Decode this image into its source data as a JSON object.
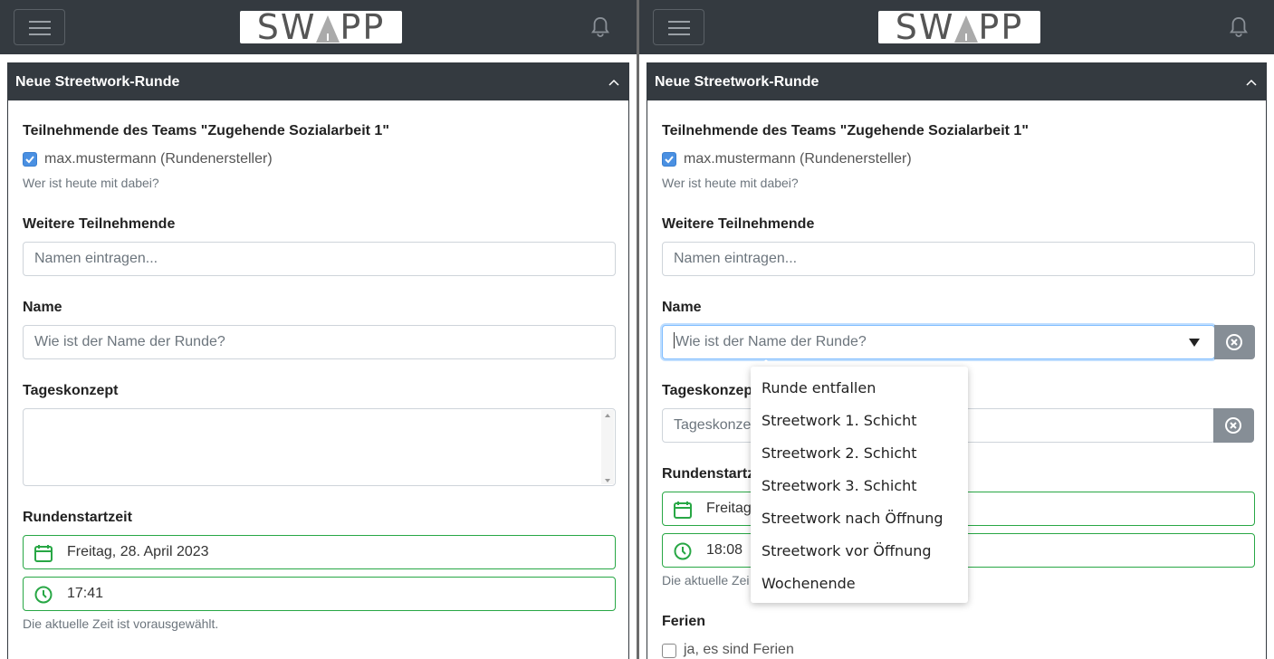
{
  "app": {
    "logo_text_left": "SW",
    "logo_text_right": "PP"
  },
  "card": {
    "title": "Neue Streetwork-Runde"
  },
  "left": {
    "team_label": "Teilnehmende des Teams \"Zugehende Sozialarbeit 1\"",
    "participant": "max.mustermann (Rundenersteller)",
    "participant_help": "Wer ist heute mit dabei?",
    "more_label": "Weitere Teilnehmende",
    "more_placeholder": "Namen eintragen...",
    "name_label": "Name",
    "name_placeholder": "Wie ist der Name der Runde?",
    "concept_label": "Tageskonzept",
    "start_label": "Rundenstartzeit",
    "date_value": "Freitag, 28. April 2023",
    "time_value": "17:41",
    "time_help": "Die aktuelle Zeit ist vorausgewählt."
  },
  "right": {
    "team_label": "Teilnehmende des Teams \"Zugehende Sozialarbeit 1\"",
    "participant": "max.mustermann (Rundenersteller)",
    "participant_help": "Wer ist heute mit dabei?",
    "more_label": "Weitere Teilnehmende",
    "more_placeholder": "Namen eintragen...",
    "name_label": "Name",
    "name_placeholder": "Wie ist der Name der Runde?",
    "concept_label": "Tageskonzep",
    "concept_placeholder": "Tageskonze",
    "start_label": "Rundenstartz",
    "date_value": "Freitag",
    "time_value": "18:08",
    "time_help": "Die aktuelle Zei",
    "holiday_label": "Ferien",
    "holiday_option": "ja, es sind Ferien",
    "dropdown_options": [
      "Runde entfallen",
      "Streetwork 1. Schicht",
      "Streetwork 2. Schicht",
      "Streetwork 3. Schicht",
      "Streetwork nach Öffnung",
      "Streetwork vor Öffnung",
      "Wochenende"
    ]
  },
  "colors": {
    "header_bg": "#343a40",
    "success": "#28a745",
    "checkbox": "#4a90e2",
    "clear_button": "#868e96"
  }
}
